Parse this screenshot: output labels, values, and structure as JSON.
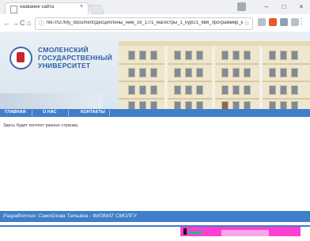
{
  "browser": {
    "tab_title": "название сайта",
    "tab_close": "×",
    "window_buttons": [
      "–",
      "□",
      "×"
    ],
    "nav_back": "←",
    "nav_forward": "→",
    "nav_reload": "C",
    "nav_home": "⌂",
    "address_url": "file:///D:/My_document/Дисциплины_нем_16_17/1_магистры_1_курс/1_6в6_программир_магистры/",
    "star": "☆",
    "menu": "⋮"
  },
  "header": {
    "uni_line1": "СМОЛЕНСКИЙ",
    "uni_line2": "ГОСУДАРСТВЕННЫЙ",
    "uni_line3": "УНИВЕРСИТЕТ"
  },
  "nav": {
    "items": [
      "ГЛАВНАЯ",
      "О НАС",
      "КОНТАКТЫ"
    ]
  },
  "main": {
    "placeholder_text": "Здесь будет контент разных страниц"
  },
  "footer": {
    "text": "Разработчик: Самойлова Татьяна - ФИЗМАТ СМОЛГУ"
  },
  "colors": {
    "brand_blue": "#3f7fc9",
    "logo_red": "#c9272f"
  }
}
